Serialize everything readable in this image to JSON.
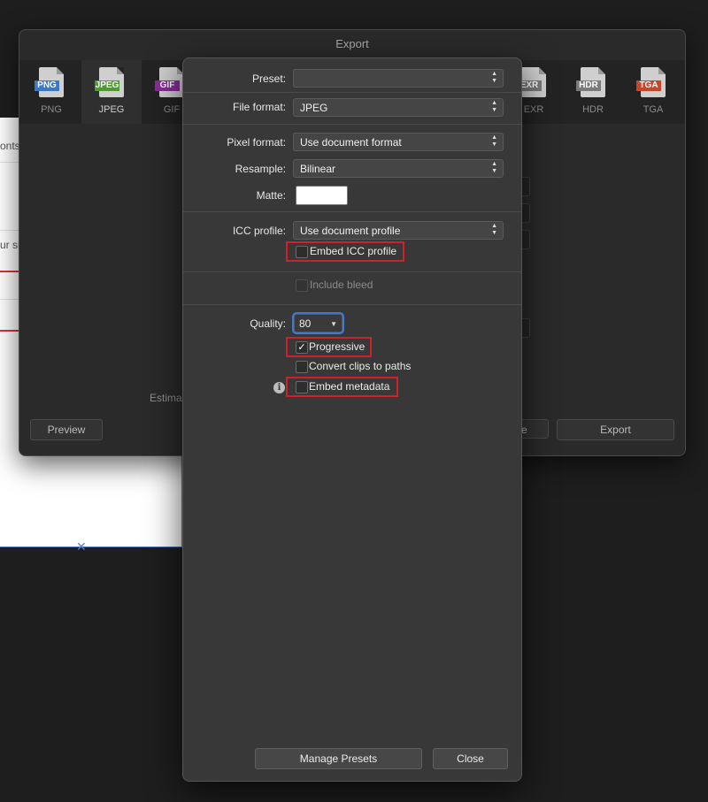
{
  "background_doc": {
    "fragments": [
      "onts",
      "ur si"
    ]
  },
  "export_window": {
    "title": "Export",
    "formats": [
      {
        "tag": "PNG",
        "label": "PNG",
        "color": "#3a78c9"
      },
      {
        "tag": "JPEG",
        "label": "JPEG",
        "color": "#4e9a2f"
      },
      {
        "tag": "GIF",
        "label": "GIF",
        "color": "#8a2d9c"
      },
      {
        "tag": "EXR",
        "label": "EXR",
        "color": "#7a7a7a"
      },
      {
        "tag": "HDR",
        "label": "HDR",
        "color": "#7a7a7a"
      },
      {
        "tag": "TGA",
        "label": "TGA",
        "color": "#c9452a"
      }
    ],
    "estimate_label": "Estima",
    "preview_button": "Preview",
    "partial_button": "e",
    "export_button": "Export"
  },
  "panel": {
    "preset": {
      "label": "Preset:",
      "value": ""
    },
    "file_format": {
      "label": "File format:",
      "value": "JPEG"
    },
    "pixel_format": {
      "label": "Pixel format:",
      "value": "Use document format"
    },
    "resample": {
      "label": "Resample:",
      "value": "Bilinear"
    },
    "matte": {
      "label": "Matte:",
      "color": "#ffffff"
    },
    "icc_profile": {
      "label": "ICC profile:",
      "value": "Use document profile"
    },
    "embed_icc": {
      "label": "Embed ICC profile",
      "checked": false
    },
    "include_bleed": {
      "label": "Include bleed",
      "checked": false
    },
    "quality": {
      "label": "Quality:",
      "value": "80"
    },
    "progressive": {
      "label": "Progressive",
      "checked": true,
      "mark": "✓"
    },
    "convert_clips": {
      "label": "Convert clips to paths",
      "checked": false
    },
    "embed_metadata": {
      "label": "Embed metadata",
      "checked": false
    },
    "info_glyph": "i",
    "manage_presets_button": "Manage Presets",
    "close_button": "Close",
    "highlight_color": "#d0202a"
  }
}
